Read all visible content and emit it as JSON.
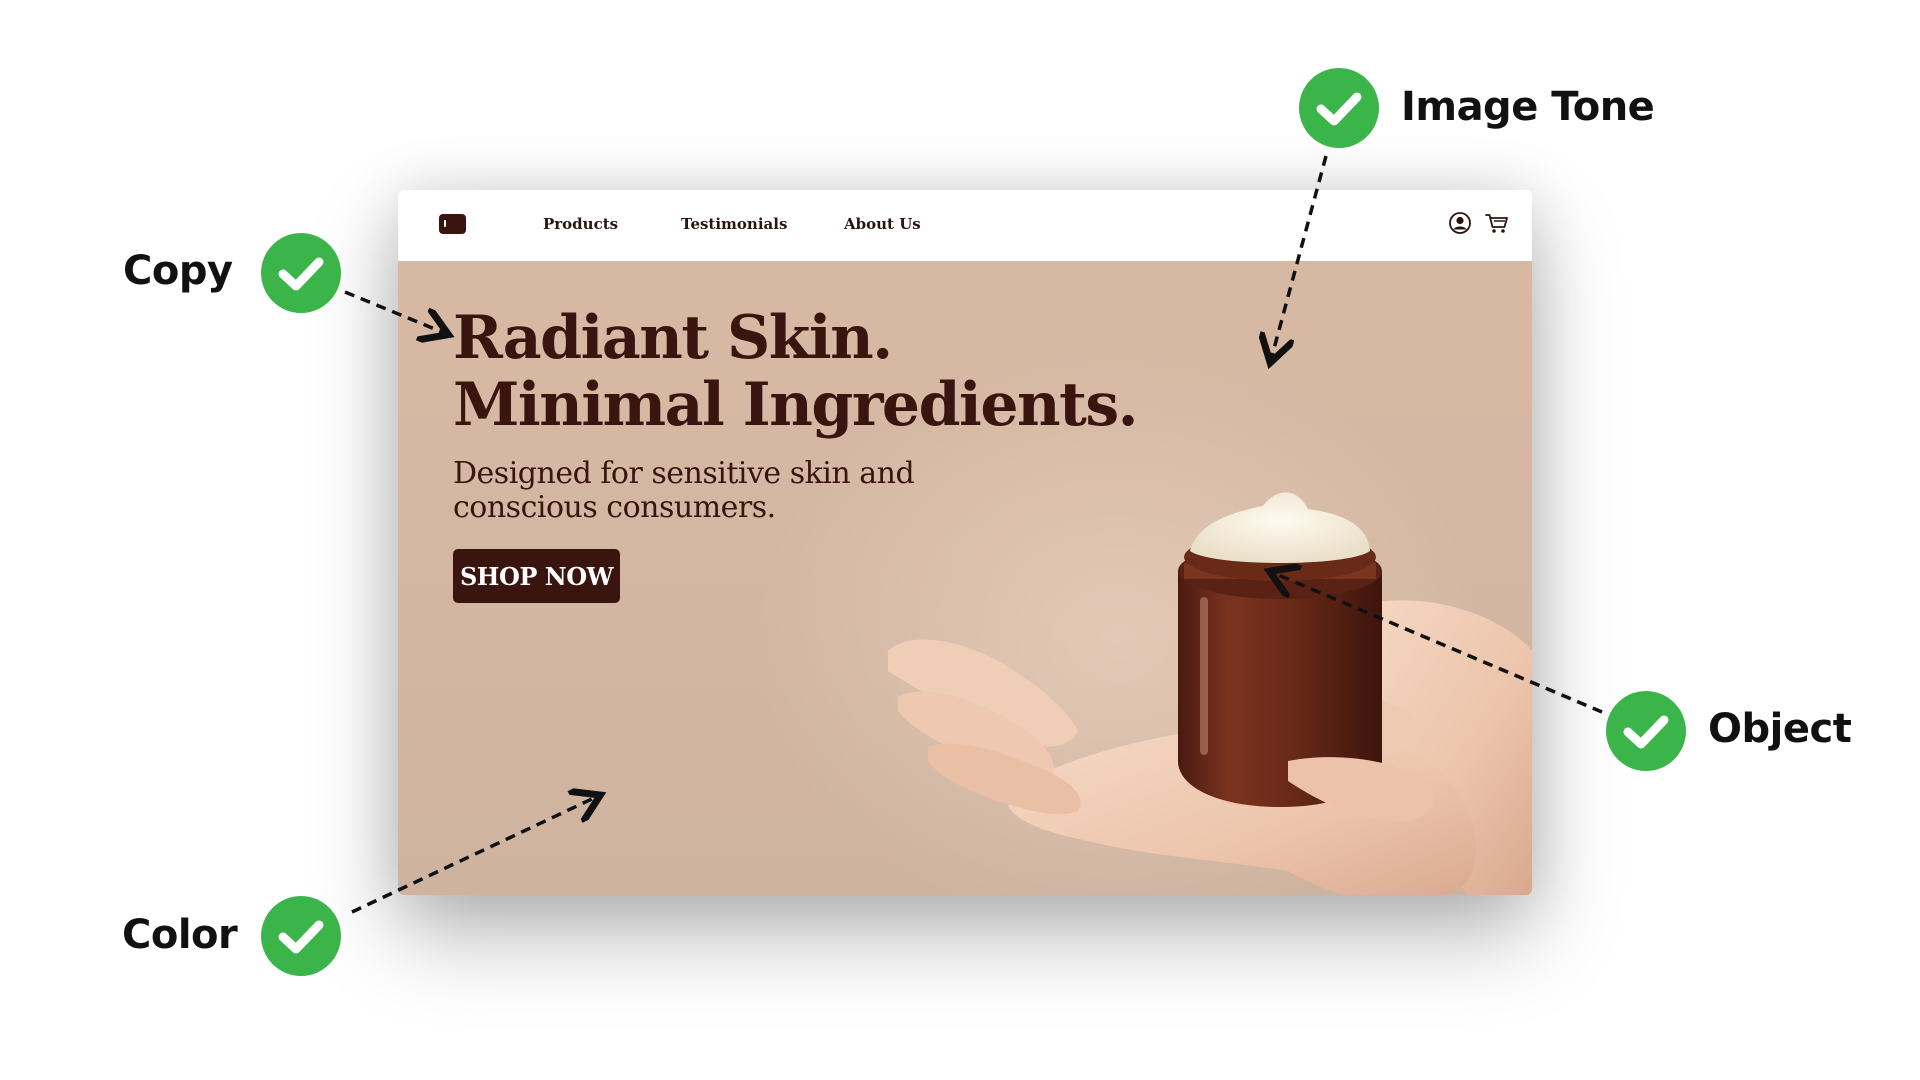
{
  "site": {
    "nav": {
      "links": [
        "Products",
        "Testimonials",
        "About Us"
      ],
      "logo_icon": "brand-jar-logo",
      "user_icon": "user-circle-icon",
      "cart_icon": "shopping-cart-icon"
    },
    "hero": {
      "title_line1": "Radiant Skin.",
      "title_line2": "Minimal Ingredients.",
      "subtitle_line1": "Designed for sensitive skin and",
      "subtitle_line2": "conscious consumers.",
      "cta_label": "SHOP NOW",
      "image": "hand-holding-amber-cream-jar"
    }
  },
  "callouts": {
    "copy": "Copy",
    "color": "Color",
    "image_tone": "Image Tone",
    "object": "Object",
    "check_icon": "green-check-circle-icon"
  },
  "colors": {
    "brand_dark": "#3a1510",
    "hero_bg": "#d4b7a3",
    "check_green": "#3bb54a",
    "page_bg": "#ffffff"
  }
}
